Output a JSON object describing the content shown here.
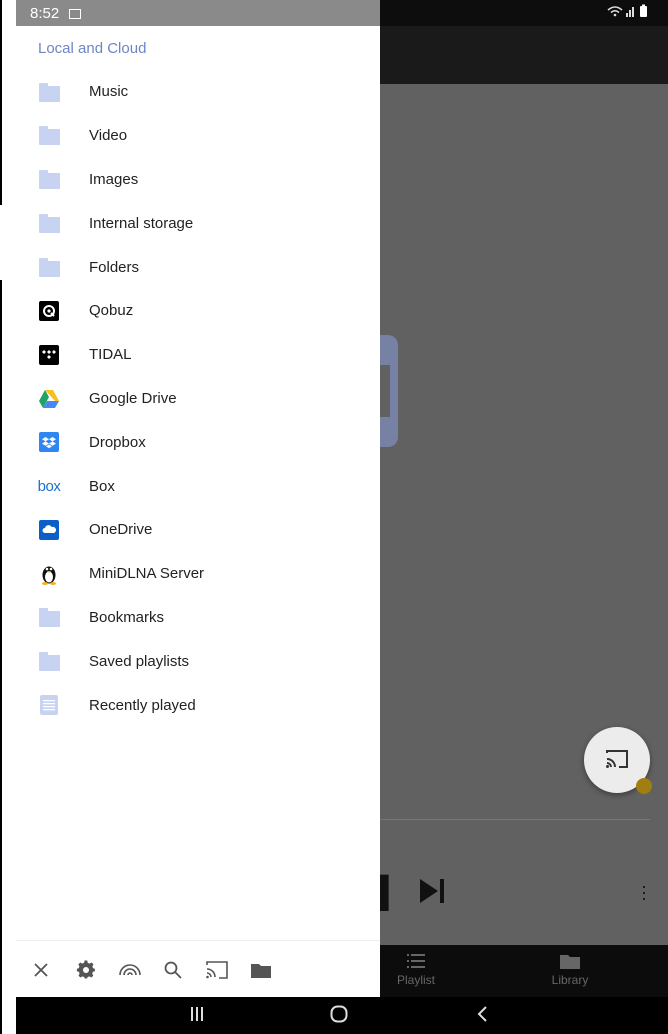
{
  "status_bar": {
    "time": "8:52",
    "right_icons": "wifi-signal-battery"
  },
  "drawer": {
    "section_header": "Local and Cloud",
    "items": [
      {
        "label": "Music",
        "icon": "folder-icon"
      },
      {
        "label": "Video",
        "icon": "folder-icon"
      },
      {
        "label": "Images",
        "icon": "folder-icon"
      },
      {
        "label": "Internal storage",
        "icon": "folder-icon"
      },
      {
        "label": "Folders",
        "icon": "folder-icon"
      },
      {
        "label": "Qobuz",
        "icon": "qobuz-icon"
      },
      {
        "label": "TIDAL",
        "icon": "tidal-icon"
      },
      {
        "label": "Google Drive",
        "icon": "google-drive-icon"
      },
      {
        "label": "Dropbox",
        "icon": "dropbox-icon"
      },
      {
        "label": "Box",
        "icon": "box-icon"
      },
      {
        "label": "OneDrive",
        "icon": "onedrive-icon"
      },
      {
        "label": "MiniDLNA Server",
        "icon": "linux-penguin-icon"
      },
      {
        "label": "Bookmarks",
        "icon": "folder-icon"
      },
      {
        "label": "Saved playlists",
        "icon": "folder-icon"
      },
      {
        "label": "Recently played",
        "icon": "list-icon"
      }
    ],
    "box_logo_text": "box",
    "bottom_bar": [
      "close-icon",
      "settings-gear-icon",
      "network-icon",
      "search-icon",
      "cast-icon",
      "folder-icon"
    ]
  },
  "background": {
    "bottom_nav": [
      {
        "label": "Playlist",
        "icon": "list-icon"
      },
      {
        "label": "Library",
        "icon": "folder-icon"
      }
    ]
  },
  "colors": {
    "accent": "#6e85c6",
    "folder": "#c8d3f2",
    "drawer_bg": "#ffffff",
    "scrim": "#616161"
  }
}
